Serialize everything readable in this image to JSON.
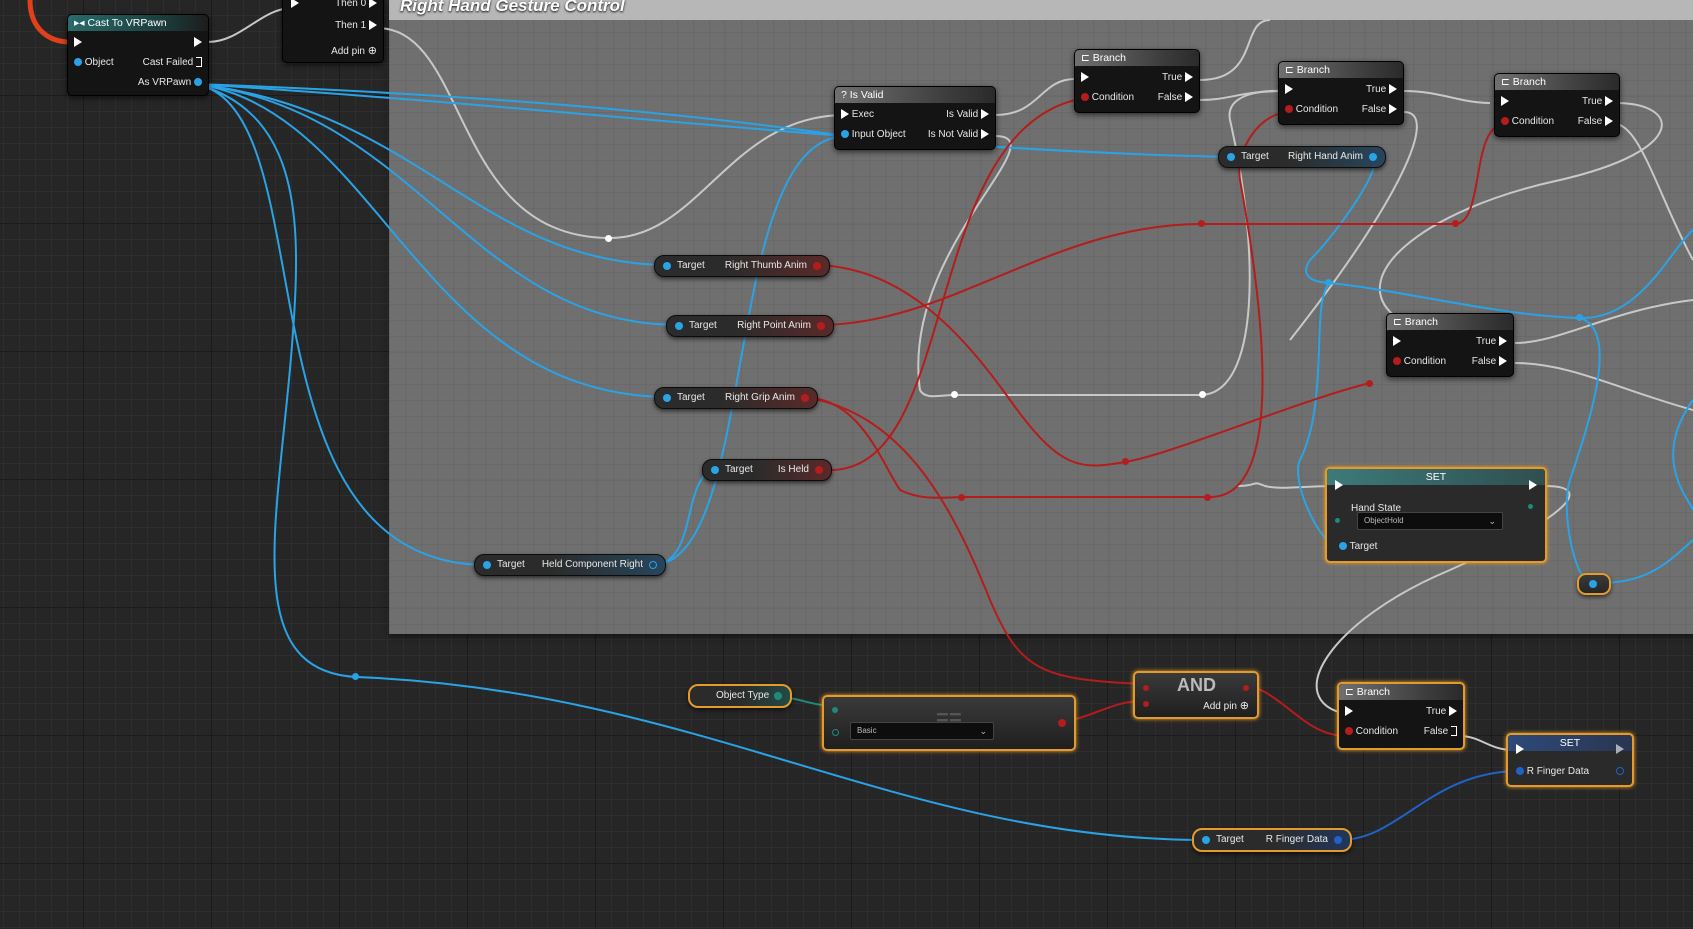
{
  "comment": {
    "title": "Right Hand Gesture Control"
  },
  "cast_node": {
    "title": "Cast To VRPawn",
    "object": "Object",
    "cast_failed": "Cast Failed",
    "as_vrpawn": "As VRPawn"
  },
  "sequence_node": {
    "then0": "Then 0",
    "then1": "Then 1",
    "add_pin": "Add pin"
  },
  "is_valid": {
    "title": "Is Valid",
    "exec": "Exec",
    "input_object": "Input Object",
    "is_valid": "Is Valid",
    "is_not_valid": "Is Not Valid"
  },
  "branch": {
    "title": "Branch",
    "true": "True",
    "false": "False",
    "condition": "Condition"
  },
  "getters": {
    "target": "Target",
    "right_hand_anim": "Right Hand Anim",
    "right_thumb_anim": "Right Thumb Anim",
    "right_point_anim": "Right Point Anim",
    "right_grip_anim": "Right Grip Anim",
    "is_held": "Is Held",
    "held_component_right": "Held Component Right",
    "object_type": "Object Type",
    "r_finger_data": "R Finger Data"
  },
  "set_hand_state": {
    "title": "SET",
    "hand_state": "Hand State",
    "value": "ObjectHold",
    "target": "Target"
  },
  "equals_node": {
    "symbol": "==",
    "dropdown": "Basic"
  },
  "and_node": {
    "title": "AND",
    "add_pin": "Add pin"
  },
  "set_finger": {
    "title": "SET",
    "label": "R Finger Data"
  },
  "colors": {
    "exec": "#ffffff",
    "object": "#2aa3e6",
    "bool": "#b51c1c",
    "enum": "#1f8a7b",
    "struct": "#1f62c8",
    "selection": "#e49b2b"
  }
}
